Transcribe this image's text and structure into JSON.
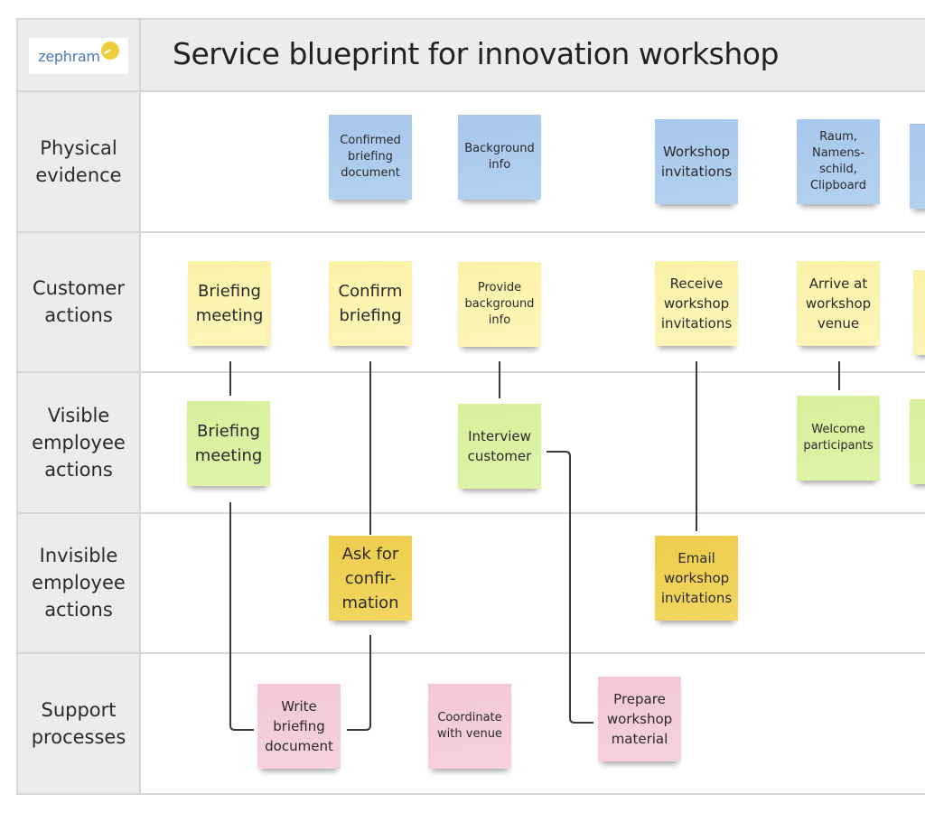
{
  "header": {
    "logo_text": "zephram",
    "title": "Service blueprint for innovation workshop"
  },
  "lanes": [
    {
      "id": "physical",
      "label": "Physical\nevidence"
    },
    {
      "id": "customer",
      "label": "Customer\nactions"
    },
    {
      "id": "visible",
      "label": "Visible\nemployee\nactions"
    },
    {
      "id": "invisible",
      "label": "Invisible\nemployee\nactions"
    },
    {
      "id": "support",
      "label": "Support\nprocesses"
    }
  ],
  "notes": {
    "physical": [
      {
        "text": "Confirmed\nbriefing\ndocument",
        "color": "blue"
      },
      {
        "text": "Background\ninfo",
        "color": "blue"
      },
      {
        "text": "Workshop\ninvitations",
        "color": "blue"
      },
      {
        "text": "Raum,\nNamens-\nschild,\nClipboard",
        "color": "blue"
      },
      {
        "text": "",
        "color": "blue"
      }
    ],
    "customer": [
      {
        "text": "Briefing\nmeeting",
        "color": "yellow"
      },
      {
        "text": "Confirm\nbriefing",
        "color": "yellow"
      },
      {
        "text": "Provide\nbackground\ninfo",
        "color": "yellow"
      },
      {
        "text": "Receive\nworkshop\ninvitations",
        "color": "yellow"
      },
      {
        "text": "Arrive at\nworkshop\nvenue",
        "color": "yellow"
      },
      {
        "text": "",
        "color": "yellow"
      }
    ],
    "visible": [
      {
        "text": "Briefing\nmeeting",
        "color": "green"
      },
      {
        "text": "Interview\ncustomer",
        "color": "green"
      },
      {
        "text": "Welcome\nparticipants",
        "color": "green"
      },
      {
        "text": "",
        "color": "green"
      }
    ],
    "invisible": [
      {
        "text": "Ask for\nconfir-\nmation",
        "color": "gold"
      },
      {
        "text": "Email\nworkshop\ninvitations",
        "color": "gold"
      }
    ],
    "support": [
      {
        "text": "Write\nbriefing\ndocument",
        "color": "pink"
      },
      {
        "text": "Coordinate\nwith venue",
        "color": "pink"
      },
      {
        "text": "Prepare\nworkshop\nmaterial",
        "color": "pink"
      }
    ]
  },
  "colors": {
    "blue": "#a7c7ec",
    "yellow": "#fbf2a8",
    "green": "#d8f09b",
    "gold": "#eecd4c",
    "pink": "#f3c8d9",
    "grid": "#d6d6d6",
    "label_bg": "#ececec",
    "connector": "#3a3a3a"
  },
  "connections": [
    {
      "from": "customer.0",
      "to": "visible.0"
    },
    {
      "from": "visible.0",
      "to": "support.0"
    },
    {
      "from": "customer.1",
      "to": "invisible.0"
    },
    {
      "from": "invisible.0",
      "to": "support.0"
    },
    {
      "from": "customer.2",
      "to": "visible.1"
    },
    {
      "from": "visible.1",
      "to": "support.2"
    },
    {
      "from": "customer.3",
      "to": "invisible.1"
    },
    {
      "from": "customer.4",
      "to": "visible.2"
    }
  ]
}
